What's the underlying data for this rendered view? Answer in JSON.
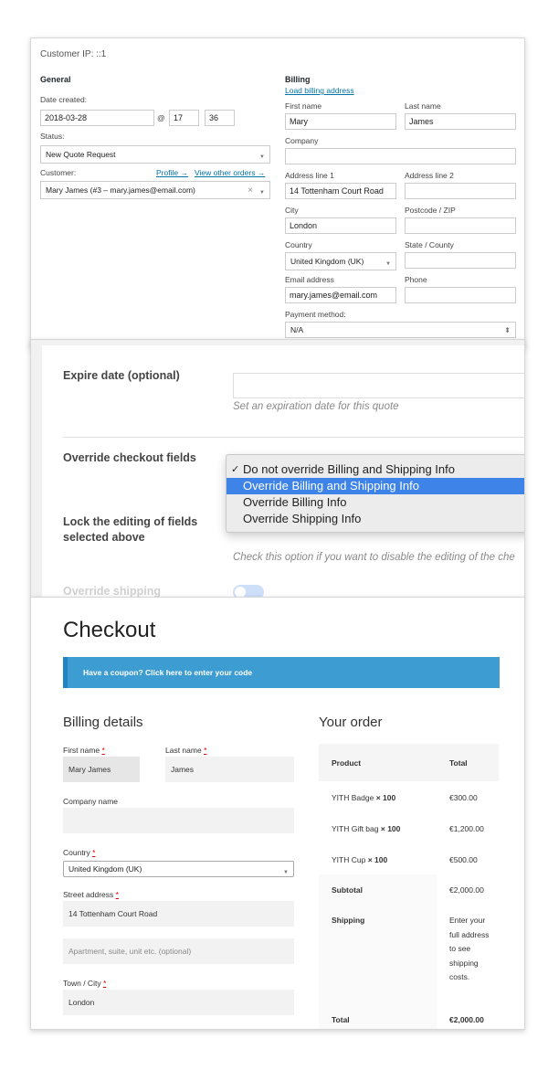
{
  "admin": {
    "customer_ip": "Customer IP: ::1",
    "general_heading": "General",
    "date_created_label": "Date created:",
    "date_value": "2018-03-28",
    "at_sign": "@",
    "hour_value": "17",
    "minute_value": "36",
    "status_label": "Status:",
    "status_value": "New Quote Request",
    "customer_label": "Customer:",
    "profile_link": "Profile →",
    "view_orders_link": "View other orders →",
    "customer_value": "Mary James (#3 – mary.james@email.com)",
    "clear_symbol": "×",
    "billing": {
      "heading": "Billing",
      "load_link": "Load billing address",
      "first_name_label": "First name",
      "first_name": "Mary",
      "last_name_label": "Last name",
      "last_name": "James",
      "company_label": "Company",
      "company": "",
      "address1_label": "Address line 1",
      "address1": "14 Tottenham Court Road",
      "address2_label": "Address line 2",
      "address2": "",
      "city_label": "City",
      "city": "London",
      "postcode_label": "Postcode / ZIP",
      "postcode": "",
      "country_label": "Country",
      "country": "United Kingdom (UK)",
      "state_label": "State / County",
      "state": "",
      "email_label": "Email address",
      "email": "mary.james@email.com",
      "phone_label": "Phone",
      "phone": "",
      "payment_label": "Payment method:",
      "payment": "N/A"
    }
  },
  "settings": {
    "expire_label": "Expire date (optional)",
    "expire_help": "Set an expiration date for this quote",
    "override_label": "Override checkout fields",
    "dropdown_options": [
      "Do not override Billing and Shipping Info",
      "Override Billing and Shipping Info",
      "Override Billing Info",
      "Override Shipping Info"
    ],
    "checked_mark": "✓",
    "lock_label": "Lock the editing of fields selected above",
    "lock_help": "Check this option if you want to disable the editing of the che",
    "override_shipping_label": "Override shipping"
  },
  "checkout": {
    "title": "Checkout",
    "coupon_text": "Have a coupon? Click here to enter your code",
    "billing_title": "Billing details",
    "first_name_label": "First name",
    "first_name": "Mary James",
    "last_name_label": "Last name",
    "last_name": "James",
    "required_mark": "*",
    "company_label": "Company name",
    "company": "",
    "country_label": "Country",
    "country": "United Kingdom (UK)",
    "street_label": "Street address",
    "street": "14 Tottenham Court Road",
    "apartment_placeholder": "Apartment, suite, unit etc. (optional)",
    "town_label": "Town / City",
    "town": "London",
    "order_title": "Your order",
    "col_product": "Product",
    "col_total": "Total",
    "items": [
      {
        "name": "YITH Badge",
        "qty": "× 100",
        "total": "€300.00"
      },
      {
        "name": "YITH Gift bag",
        "qty": "× 100",
        "total": "€1,200.00"
      },
      {
        "name": "YITH Cup",
        "qty": "× 100",
        "total": "€500.00"
      }
    ],
    "subtotal_label": "Subtotal",
    "subtotal": "€2,000.00",
    "shipping_label": "Shipping",
    "shipping_note": "Enter your full address to see shipping costs.",
    "total_label": "Total",
    "total": "€2,000.00"
  }
}
